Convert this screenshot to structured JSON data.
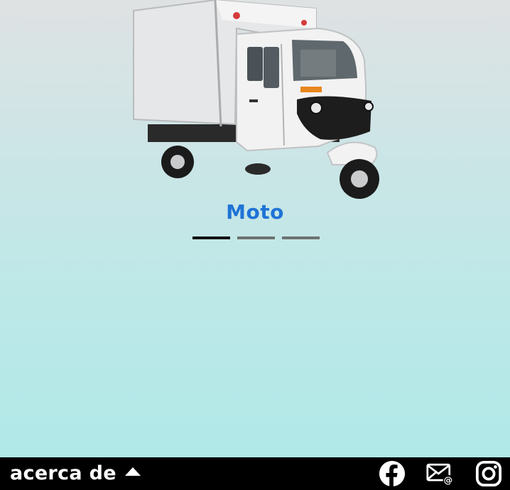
{
  "slide": {
    "title": "Moto",
    "image": "cargo-motorcycle-truck",
    "current_index": 1,
    "total": 3
  },
  "footer": {
    "about_label": "acerca de",
    "about_icon": "caret-up-icon",
    "social": [
      "facebook-icon",
      "email-icon",
      "instagram-icon"
    ]
  },
  "colors": {
    "title": "#1f73d6",
    "footer_bg": "#000000",
    "pager_active": "#111111",
    "pager_inactive": "#6e7272"
  }
}
